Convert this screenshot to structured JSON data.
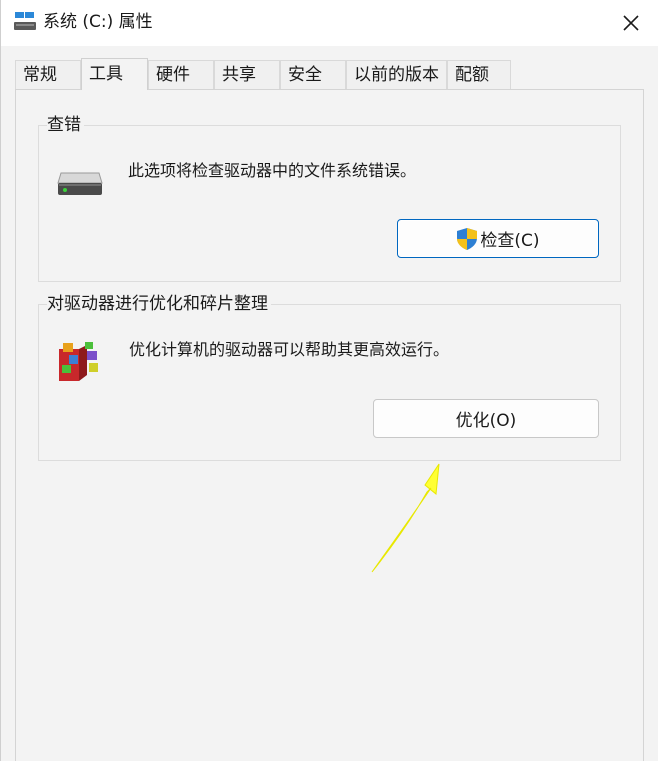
{
  "window": {
    "title": "系统 (C:) 属性",
    "close_icon": "close-icon"
  },
  "tabs": [
    {
      "label": "常规",
      "active": false
    },
    {
      "label": "工具",
      "active": true
    },
    {
      "label": "硬件",
      "active": false
    },
    {
      "label": "共享",
      "active": false
    },
    {
      "label": "安全",
      "active": false
    },
    {
      "label": "以前的版本",
      "active": false
    },
    {
      "label": "配额",
      "active": false
    }
  ],
  "error_check": {
    "title": "查错",
    "icon": "drive-icon",
    "description": "此选项将检查驱动器中的文件系统错误。",
    "button_label": "检查(C)",
    "button_icon": "uac-shield-icon"
  },
  "optimize": {
    "title": "对驱动器进行优化和碎片整理",
    "icon": "defrag-icon",
    "description": "优化计算机的驱动器可以帮助其更高效运行。",
    "button_label": "优化(O)"
  },
  "annotation": {
    "arrow_color": "#ffff33",
    "icon": "yellow-arrow-icon"
  },
  "colors": {
    "accent": "#0067c0",
    "background": "#f3f3f3"
  }
}
